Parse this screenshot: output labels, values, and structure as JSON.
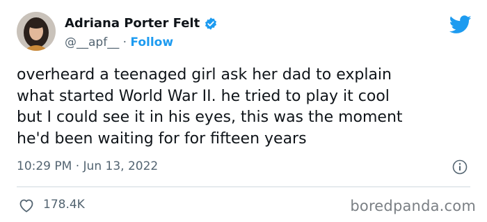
{
  "author": {
    "name": "Adriana Porter Felt",
    "handle": "@__apf__",
    "separator": "·",
    "follow_label": "Follow",
    "verified_color": "#1d9bf0"
  },
  "tweet": {
    "text": "overheard a teenaged girl ask her dad to explain\nwhat started World War II. he tried to play it cool\nbut I could see it in his eyes, this was the moment\nhe'd been waiting for for fifteen years",
    "time": "10:29 PM",
    "date_separator": "·",
    "date": "Jun 13, 2022",
    "likes": "178.4K"
  },
  "icons": {
    "twitter": "twitter-bird-icon",
    "verified": "verified-badge-icon",
    "info": "info-icon",
    "like": "heart-icon"
  },
  "colors": {
    "accent": "#1d9bf0",
    "text": "#0f1419",
    "secondary": "#536471"
  },
  "watermark": "boredpanda.com"
}
